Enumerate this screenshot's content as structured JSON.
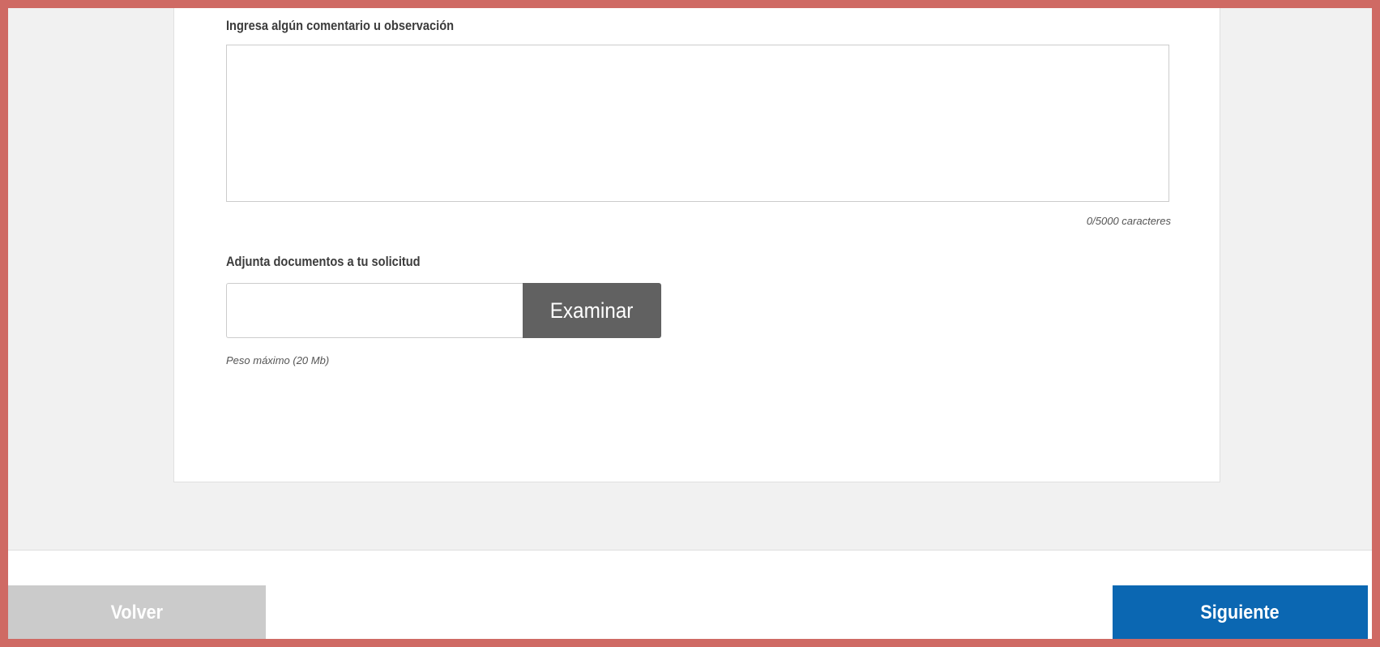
{
  "form": {
    "comment_label": "Ingresa algún comentario u observación",
    "comment_value": "",
    "comment_counter": "0/5000 caracteres",
    "attach_label": "Adjunta documentos a tu solicitud",
    "file_value": "",
    "browse_button": "Examinar",
    "max_weight_note": "Peso máximo (20 Mb)"
  },
  "footer": {
    "back_button": "Volver",
    "next_button": "Siguiente"
  },
  "colors": {
    "frame_border": "#cf6a64",
    "background_gray": "#f1f1f1",
    "browse_button": "#616161",
    "back_button_disabled": "#cbcbcb",
    "next_button_primary": "#0b67b2"
  }
}
